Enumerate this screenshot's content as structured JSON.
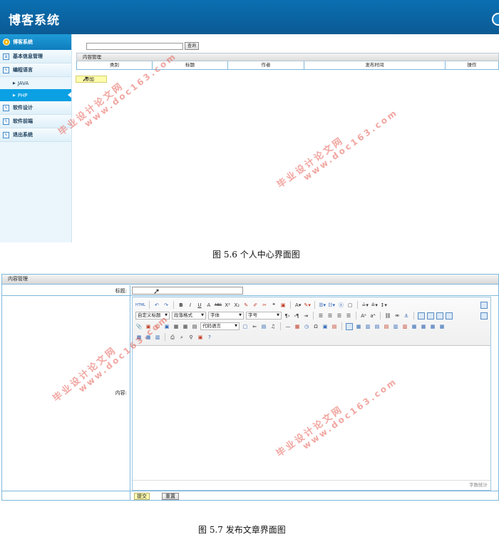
{
  "screen1": {
    "app_title": "博客系统",
    "sidebar": {
      "header": "博客系统",
      "items": [
        {
          "label": "基本信息管理",
          "icon": "list-icon"
        },
        {
          "label": "编程语言",
          "icon": "edit-icon"
        },
        {
          "label": "JAVA",
          "sub": true
        },
        {
          "label": "PHP",
          "sub": true,
          "active": true
        },
        {
          "label": "软件设计",
          "icon": "edit-icon"
        },
        {
          "label": "软件前端",
          "icon": "edit-icon"
        },
        {
          "label": "退出系统",
          "icon": "edit-icon"
        }
      ]
    },
    "search": {
      "placeholder": "",
      "button": "查询"
    },
    "panel_title": "内容管理",
    "columns": [
      "类别",
      "标题",
      "作者",
      "发布时间",
      "操作"
    ],
    "add_button": "添加"
  },
  "caption1": "图 5.6 个人中心界面图",
  "screen2": {
    "panel_title": "内容管理",
    "title_label": "标题:",
    "content_label": "内容:",
    "title_value": "",
    "editor": {
      "heading_select": "自定义标题",
      "paragraph_select": "段落格式",
      "font_select": "字体",
      "size_select": "字号",
      "code_select": "代码语言",
      "html_button": "HTML",
      "word_count": "字数统计"
    },
    "submit_button": "提交",
    "reset_button": "重置"
  },
  "caption2": "图 5.7 发布文章界面图",
  "watermark": {
    "text": "毕业设计论文网",
    "url": "www.doc163.com",
    "color": "#e55c54"
  },
  "colors": {
    "header": "#0b5a94",
    "active": "#0ba0e3",
    "border": "#7fb8dc",
    "yellow_button": "#fffcae"
  }
}
